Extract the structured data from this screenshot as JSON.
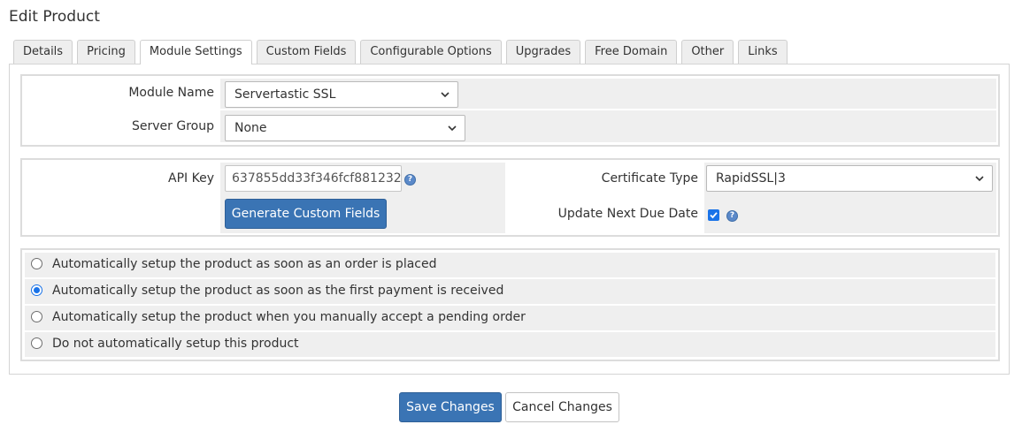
{
  "page": {
    "title": "Edit Product"
  },
  "tabs": [
    {
      "label": "Details"
    },
    {
      "label": "Pricing"
    },
    {
      "label": "Module Settings"
    },
    {
      "label": "Custom Fields"
    },
    {
      "label": "Configurable Options"
    },
    {
      "label": "Upgrades"
    },
    {
      "label": "Free Domain"
    },
    {
      "label": "Other"
    },
    {
      "label": "Links"
    }
  ],
  "active_tab": "Module Settings",
  "module": {
    "name_label": "Module Name",
    "name_value": "Servertastic SSL",
    "server_group_label": "Server Group",
    "server_group_value": "None"
  },
  "config": {
    "api_key_label": "API Key",
    "api_key_value": "637855dd33f346fcf881232",
    "generate_button": "Generate Custom Fields",
    "cert_type_label": "Certificate Type",
    "cert_type_value": "RapidSSL|3",
    "update_due_label": "Update Next Due Date",
    "update_due_checked": true,
    "help_glyph": "?"
  },
  "setup_options": [
    {
      "label": "Automatically setup the product as soon as an order is placed",
      "checked": false
    },
    {
      "label": "Automatically setup the product as soon as the first payment is received",
      "checked": true
    },
    {
      "label": "Automatically setup the product when you manually accept a pending order",
      "checked": false
    },
    {
      "label": "Do not automatically setup this product",
      "checked": false
    }
  ],
  "actions": {
    "save": "Save Changes",
    "cancel": "Cancel Changes"
  },
  "colors": {
    "primary": "#3a74b4",
    "checkbox": "#1a73e8",
    "field_bg": "#efefef"
  },
  "icons": {
    "help": "help-icon",
    "select": "chevron-down-icon",
    "check": "checkmark-icon"
  }
}
